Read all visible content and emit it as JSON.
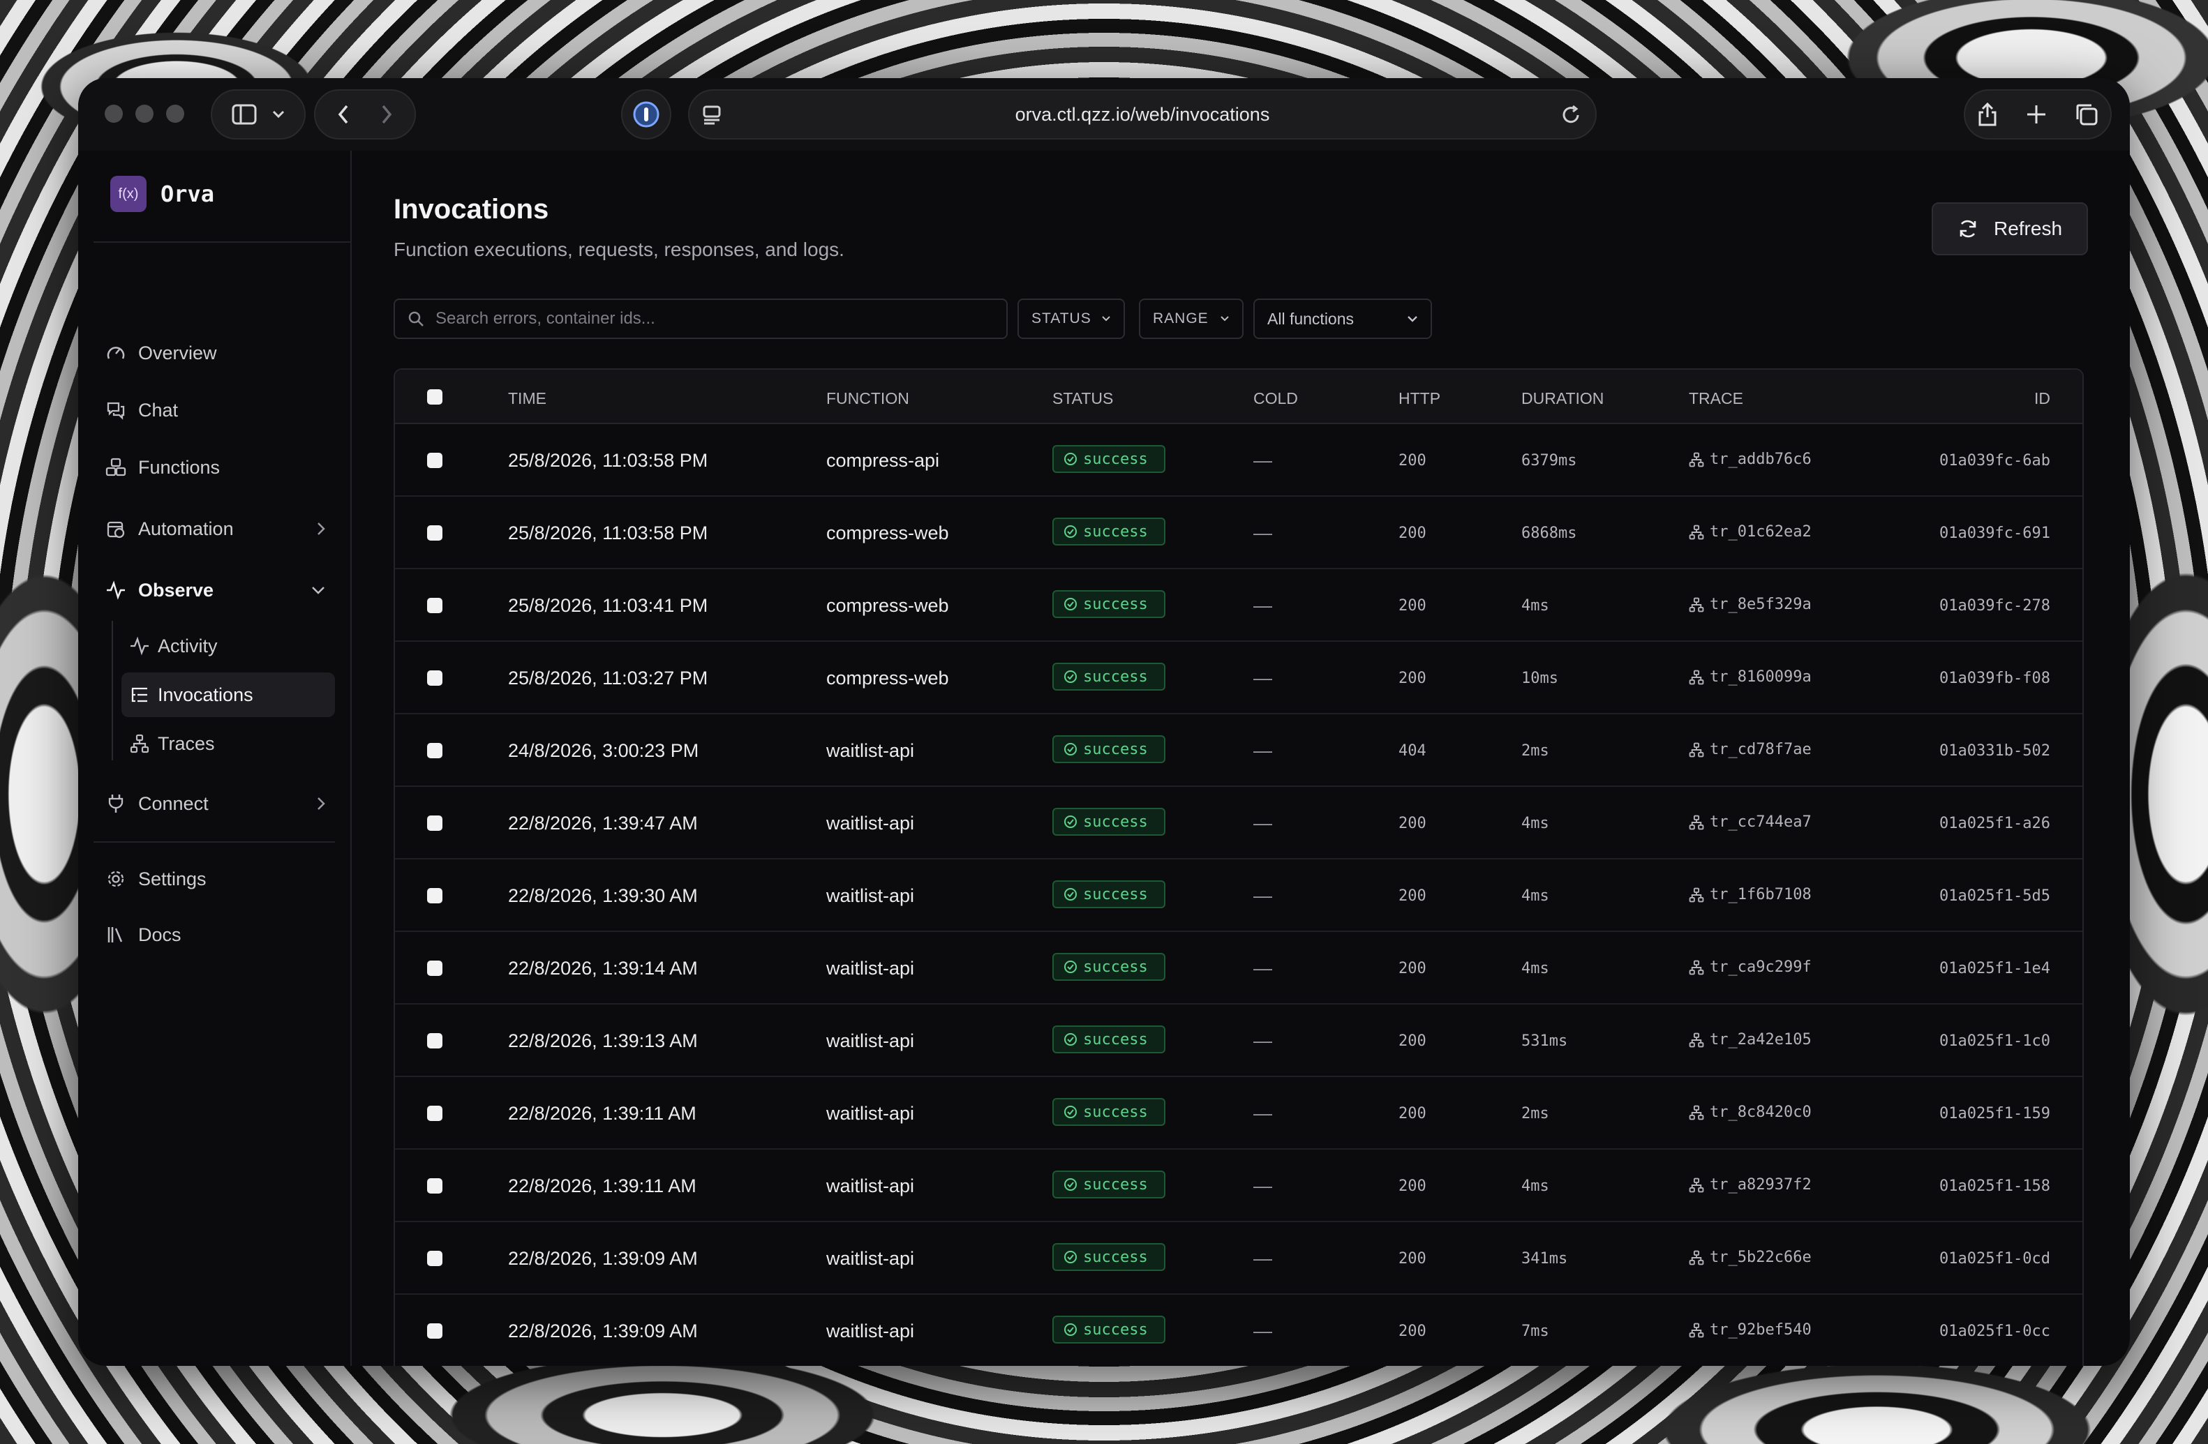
{
  "browser": {
    "url": "orva.ctl.qzz.io/web/invocations"
  },
  "app": {
    "logo_text": "f(x)",
    "name": "Orva"
  },
  "sidebar": {
    "overview": "Overview",
    "chat": "Chat",
    "functions": "Functions",
    "automation": "Automation",
    "observe": "Observe",
    "activity": "Activity",
    "invocations": "Invocations",
    "traces": "Traces",
    "connect": "Connect",
    "settings": "Settings",
    "docs": "Docs"
  },
  "page": {
    "title": "Invocations",
    "subtitle": "Function executions, requests, responses, and logs.",
    "refresh_label": "Refresh"
  },
  "filters": {
    "search_placeholder": "Search errors, container ids...",
    "status": "STATUS",
    "range": "RANGE",
    "functions": "All functions"
  },
  "table": {
    "headers": {
      "time": "TIME",
      "function": "FUNCTION",
      "status": "STATUS",
      "cold": "COLD",
      "http": "HTTP",
      "duration": "DURATION",
      "trace": "TRACE",
      "id": "ID"
    },
    "rows": [
      {
        "time": "25/8/2026, 11:03:58 PM",
        "function": "compress-api",
        "status": "success",
        "cold": "—",
        "http": "200",
        "duration": "6379ms",
        "trace": "tr_addb76c6",
        "id": "01a039fc-6ab"
      },
      {
        "time": "25/8/2026, 11:03:58 PM",
        "function": "compress-web",
        "status": "success",
        "cold": "—",
        "http": "200",
        "duration": "6868ms",
        "trace": "tr_01c62ea2",
        "id": "01a039fc-691"
      },
      {
        "time": "25/8/2026, 11:03:41 PM",
        "function": "compress-web",
        "status": "success",
        "cold": "—",
        "http": "200",
        "duration": "4ms",
        "trace": "tr_8e5f329a",
        "id": "01a039fc-278"
      },
      {
        "time": "25/8/2026, 11:03:27 PM",
        "function": "compress-web",
        "status": "success",
        "cold": "—",
        "http": "200",
        "duration": "10ms",
        "trace": "tr_8160099a",
        "id": "01a039fb-f08"
      },
      {
        "time": "24/8/2026, 3:00:23 PM",
        "function": "waitlist-api",
        "status": "success",
        "cold": "—",
        "http": "404",
        "duration": "2ms",
        "trace": "tr_cd78f7ae",
        "id": "01a0331b-502"
      },
      {
        "time": "22/8/2026, 1:39:47 AM",
        "function": "waitlist-api",
        "status": "success",
        "cold": "—",
        "http": "200",
        "duration": "4ms",
        "trace": "tr_cc744ea7",
        "id": "01a025f1-a26"
      },
      {
        "time": "22/8/2026, 1:39:30 AM",
        "function": "waitlist-api",
        "status": "success",
        "cold": "—",
        "http": "200",
        "duration": "4ms",
        "trace": "tr_1f6b7108",
        "id": "01a025f1-5d5"
      },
      {
        "time": "22/8/2026, 1:39:14 AM",
        "function": "waitlist-api",
        "status": "success",
        "cold": "—",
        "http": "200",
        "duration": "4ms",
        "trace": "tr_ca9c299f",
        "id": "01a025f1-1e4"
      },
      {
        "time": "22/8/2026, 1:39:13 AM",
        "function": "waitlist-api",
        "status": "success",
        "cold": "—",
        "http": "200",
        "duration": "531ms",
        "trace": "tr_2a42e105",
        "id": "01a025f1-1c0"
      },
      {
        "time": "22/8/2026, 1:39:11 AM",
        "function": "waitlist-api",
        "status": "success",
        "cold": "—",
        "http": "200",
        "duration": "2ms",
        "trace": "tr_8c8420c0",
        "id": "01a025f1-159"
      },
      {
        "time": "22/8/2026, 1:39:11 AM",
        "function": "waitlist-api",
        "status": "success",
        "cold": "—",
        "http": "200",
        "duration": "4ms",
        "trace": "tr_a82937f2",
        "id": "01a025f1-158"
      },
      {
        "time": "22/8/2026, 1:39:09 AM",
        "function": "waitlist-api",
        "status": "success",
        "cold": "—",
        "http": "200",
        "duration": "341ms",
        "trace": "tr_5b22c66e",
        "id": "01a025f1-0cd"
      },
      {
        "time": "22/8/2026, 1:39:09 AM",
        "function": "waitlist-api",
        "status": "success",
        "cold": "—",
        "http": "200",
        "duration": "7ms",
        "trace": "tr_92bef540",
        "id": "01a025f1-0cc"
      }
    ]
  },
  "colors": {
    "success_text": "#5fd38d",
    "success_border": "#1d5a34",
    "brand": "#5a3b8a"
  }
}
